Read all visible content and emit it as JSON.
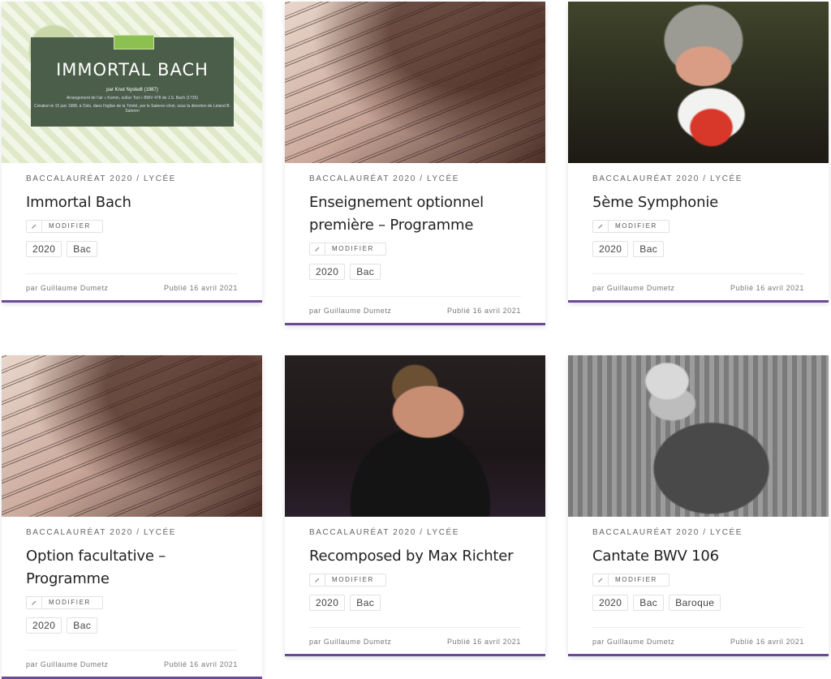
{
  "cards": [
    {
      "category": "BACCALAURÉAT 2020 / LYCÉE",
      "title": "Immortal Bach",
      "edit_label": "MODIFIER",
      "tags": [
        "2020",
        "Bac"
      ],
      "author": "par Guillaume Dumetz",
      "date": "Publié 16 avril 2021",
      "poster": {
        "title": "IMMORTAL BACH",
        "line1": "par Knut Nystedt (1987)",
        "line2": "Arrangement de l'air « Komm, süßer Tod » BWV 478 de J.S. Bach (1735)",
        "line3": "Création le 15 juin 1988, à Oslo, dans l'église de la Trinité, par le Sateren choir, sous la direction de Leland B. Sateren"
      }
    },
    {
      "category": "BACCALAURÉAT 2020 / LYCÉE",
      "title": "Enseignement optionnel première – Programme",
      "edit_label": "MODIFIER",
      "tags": [
        "2020",
        "Bac"
      ],
      "author": "par Guillaume Dumetz",
      "date": "Publié 16 avril 2021"
    },
    {
      "category": "BACCALAURÉAT 2020 / LYCÉE",
      "title": "5ème Symphonie",
      "edit_label": "MODIFIER",
      "tags": [
        "2020",
        "Bac"
      ],
      "author": "par Guillaume Dumetz",
      "date": "Publié 16 avril 2021"
    },
    {
      "category": "BACCALAURÉAT 2020 / LYCÉE",
      "title": "Option facultative – Programme",
      "edit_label": "MODIFIER",
      "tags": [
        "2020",
        "Bac"
      ],
      "author": "par Guillaume Dumetz",
      "date": "Publié 16 avril 2021"
    },
    {
      "category": "BACCALAURÉAT 2020 / LYCÉE",
      "title": "Recomposed by Max Richter",
      "edit_label": "MODIFIER",
      "tags": [
        "2020",
        "Bac"
      ],
      "author": "par Guillaume Dumetz",
      "date": "Publié 16 avril 2021"
    },
    {
      "category": "BACCALAURÉAT 2020 / LYCÉE",
      "title": "Cantate BWV 106",
      "edit_label": "MODIFIER",
      "tags": [
        "2020",
        "Bac",
        "Baroque"
      ],
      "author": "par Guillaume Dumetz",
      "date": "Publié 16 avril 2021"
    }
  ],
  "colors": {
    "accent": "#6b4a95"
  }
}
